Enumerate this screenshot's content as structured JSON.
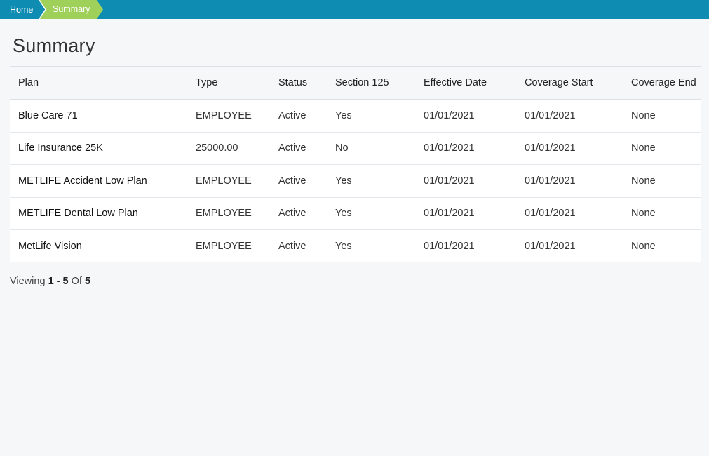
{
  "breadcrumb": {
    "home_label": "Home",
    "current_label": "Summary"
  },
  "colors": {
    "topbar": "#0f8cb2",
    "breadcrumb_active": "#9fd05a"
  },
  "page": {
    "title": "Summary"
  },
  "table": {
    "headers": [
      "Plan",
      "Type",
      "Status",
      "Section 125",
      "Effective Date",
      "Coverage Start",
      "Coverage End"
    ],
    "rows": [
      [
        "Blue Care 71",
        "EMPLOYEE",
        "Active",
        "Yes",
        "01/01/2021",
        "01/01/2021",
        "None"
      ],
      [
        "Life Insurance 25K",
        "25000.00",
        "Active",
        "No",
        "01/01/2021",
        "01/01/2021",
        "None"
      ],
      [
        "METLIFE Accident Low Plan",
        "EMPLOYEE",
        "Active",
        "Yes",
        "01/01/2021",
        "01/01/2021",
        "None"
      ],
      [
        "METLIFE Dental Low Plan",
        "EMPLOYEE",
        "Active",
        "Yes",
        "01/01/2021",
        "01/01/2021",
        "None"
      ],
      [
        "MetLife Vision",
        "EMPLOYEE",
        "Active",
        "Yes",
        "01/01/2021",
        "01/01/2021",
        "None"
      ]
    ]
  },
  "pagination": {
    "prefix": "Viewing",
    "range": "1 - 5",
    "of_label": "Of",
    "total": "5"
  }
}
